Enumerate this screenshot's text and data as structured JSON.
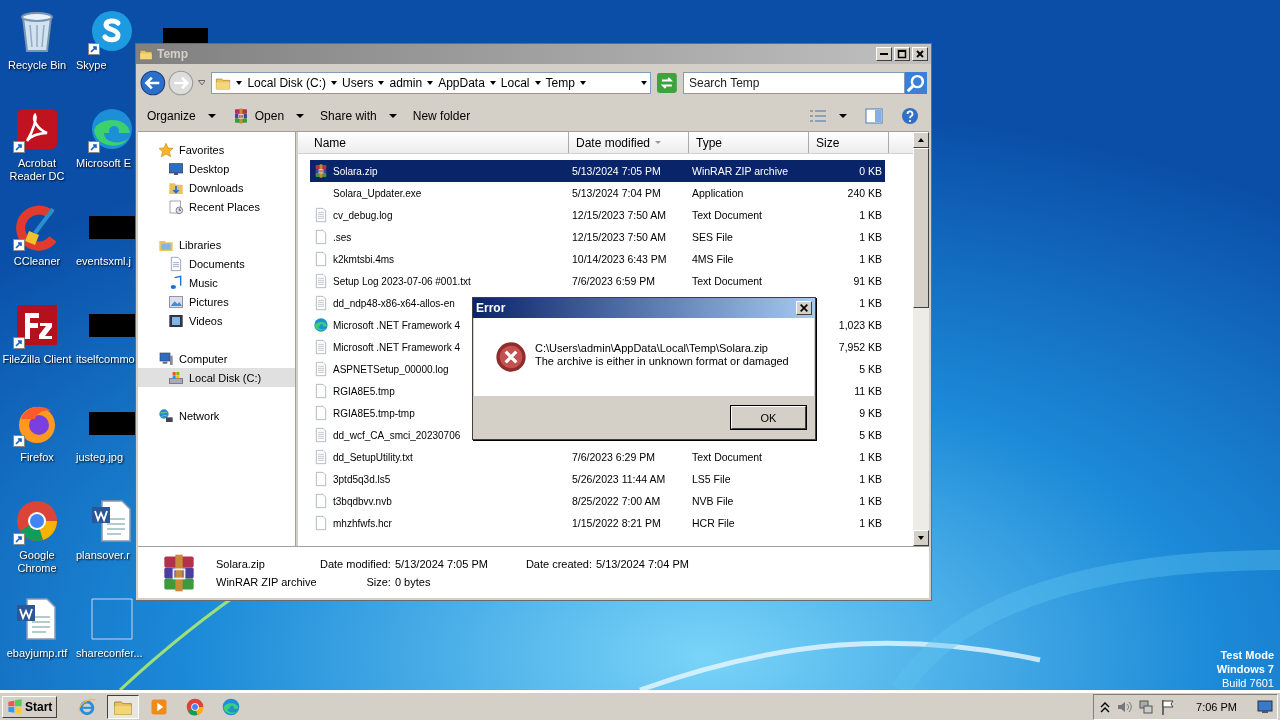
{
  "desktop": {
    "icons": [
      {
        "label": "Recycle Bin",
        "kind": "recycle",
        "shortcut": false
      },
      {
        "label": "Skype",
        "kind": "skype",
        "shortcut": true
      },
      {
        "label": "Acrobat Reader DC",
        "kind": "acrobat",
        "shortcut": true
      },
      {
        "label": "Microsoft E",
        "kind": "edge",
        "shortcut": true
      },
      {
        "label": "CCleaner",
        "kind": "ccleaner",
        "shortcut": true
      },
      {
        "label": "eventsxml.j",
        "kind": "redacted",
        "shortcut": false
      },
      {
        "label": "FileZilla Client",
        "kind": "filezilla",
        "shortcut": true
      },
      {
        "label": "itselfcommo",
        "kind": "redacted",
        "shortcut": false
      },
      {
        "label": "Firefox",
        "kind": "firefox",
        "shortcut": true
      },
      {
        "label": "justeg.jpg",
        "kind": "redacted",
        "shortcut": false
      },
      {
        "label": "Google Chrome",
        "kind": "chrome",
        "shortcut": true
      },
      {
        "label": "plansover.r",
        "kind": "word",
        "shortcut": false
      },
      {
        "label": "ebayjump.rtf",
        "kind": "word",
        "shortcut": false
      },
      {
        "label": "shareconfer...",
        "kind": "blank",
        "shortcut": false
      }
    ],
    "os_notice": [
      "Test Mode",
      "Windows 7",
      "Build 7601"
    ]
  },
  "explorer": {
    "title": "Temp",
    "breadcrumb": [
      "Local Disk (C:)",
      "Users",
      "admin",
      "AppData",
      "Local",
      "Temp"
    ],
    "search": {
      "placeholder": "Search Temp"
    },
    "toolbar": [
      {
        "label": "Organize",
        "menu": true,
        "kind": "plain"
      },
      {
        "label": "Open",
        "menu": true,
        "kind": "winrar"
      },
      {
        "label": "Share with",
        "menu": true,
        "kind": "plain"
      },
      {
        "label": "New folder",
        "menu": false,
        "kind": "plain"
      }
    ],
    "nav": [
      {
        "label": "Favorites",
        "kind": "star",
        "selected": false,
        "children": [
          {
            "label": "Desktop",
            "kind": "desktop",
            "selected": false
          },
          {
            "label": "Downloads",
            "kind": "downloads",
            "selected": false
          },
          {
            "label": "Recent Places",
            "kind": "recent",
            "selected": false
          }
        ]
      },
      {
        "label": "Libraries",
        "kind": "libraries",
        "selected": false,
        "children": [
          {
            "label": "Documents",
            "kind": "documents",
            "selected": false
          },
          {
            "label": "Music",
            "kind": "music",
            "selected": false
          },
          {
            "label": "Pictures",
            "kind": "pictures",
            "selected": false
          },
          {
            "label": "Videos",
            "kind": "videos",
            "selected": false
          }
        ]
      },
      {
        "label": "Computer",
        "kind": "computer",
        "selected": false,
        "children": [
          {
            "label": "Local Disk (C:)",
            "kind": "disk",
            "selected": true
          }
        ]
      },
      {
        "label": "Network",
        "kind": "network",
        "selected": false
      }
    ],
    "columns": [
      {
        "label": "Name",
        "sorted": false
      },
      {
        "label": "Date modified",
        "sorted": true
      },
      {
        "label": "Type",
        "sorted": false
      },
      {
        "label": "Size",
        "sorted": false
      }
    ],
    "files": [
      {
        "name": "Solara.zip",
        "date": "5/13/2024 7:05 PM",
        "type": "WinRAR ZIP archive",
        "size": "0 KB",
        "kind": "winrar",
        "selected": true
      },
      {
        "name": "Solara_Updater.exe",
        "date": "5/13/2024 7:04 PM",
        "type": "Application",
        "size": "240 KB",
        "kind": "none",
        "selected": false
      },
      {
        "name": "cv_debug.log",
        "date": "12/15/2023 7:50 AM",
        "type": "Text Document",
        "size": "1 KB",
        "kind": "text",
        "selected": false
      },
      {
        "name": ".ses",
        "date": "12/15/2023 7:50 AM",
        "type": "SES File",
        "size": "1 KB",
        "kind": "blank",
        "selected": false
      },
      {
        "name": "k2kmtsbi.4ms",
        "date": "10/14/2023 6:43 PM",
        "type": "4MS File",
        "size": "1 KB",
        "kind": "blank",
        "selected": false
      },
      {
        "name": "Setup Log 2023-07-06 #001.txt",
        "date": "7/6/2023 6:59 PM",
        "type": "Text Document",
        "size": "91 KB",
        "kind": "text",
        "selected": false
      },
      {
        "name": "dd_ndp48-x86-x64-allos-en",
        "size": "1 KB",
        "kind": "text",
        "selected": false
      },
      {
        "name": "Microsoft .NET Framework 4",
        "size": "1,023 KB",
        "kind": "edge",
        "selected": false
      },
      {
        "name": "Microsoft .NET Framework 4",
        "size": "7,952 KB",
        "kind": "text",
        "selected": false
      },
      {
        "name": "ASPNETSetup_00000.log",
        "size": "5 KB",
        "kind": "text",
        "selected": false
      },
      {
        "name": "RGIA8E5.tmp",
        "size": "11 KB",
        "kind": "blank",
        "selected": false
      },
      {
        "name": "RGIA8E5.tmp-tmp",
        "size": "9 KB",
        "kind": "blank",
        "selected": false
      },
      {
        "name": "dd_wcf_CA_smci_20230706",
        "size": "5 KB",
        "kind": "text",
        "selected": false
      },
      {
        "name": "dd_SetupUtility.txt",
        "date": "7/6/2023 6:29 PM",
        "type": "Text Document",
        "size": "1 KB",
        "kind": "text",
        "selected": false
      },
      {
        "name": "3ptd5q3d.ls5",
        "date": "5/26/2023 11:44 AM",
        "type": "LS5 File",
        "size": "1 KB",
        "kind": "blank",
        "selected": false
      },
      {
        "name": "t3bqdbvv.nvb",
        "date": "8/25/2022 7:00 AM",
        "type": "NVB File",
        "size": "1 KB",
        "kind": "blank",
        "selected": false
      },
      {
        "name": "mhzhfwfs.hcr",
        "date": "1/15/2022 8:21 PM",
        "type": "HCR File",
        "size": "1 KB",
        "kind": "blank",
        "selected": false
      }
    ],
    "details": {
      "name": "Solara.zip",
      "type": "WinRAR ZIP archive",
      "fields": [
        {
          "label": "Date modified:",
          "value": "5/13/2024 7:05 PM"
        },
        {
          "label": "Size:",
          "value": "0 bytes"
        },
        {
          "label": "Date created:",
          "value": "5/13/2024 7:04 PM"
        }
      ]
    }
  },
  "dialog": {
    "title": "Error",
    "lines": [
      "C:\\Users\\admin\\AppData\\Local\\Temp\\Solara.zip",
      "The archive is either in unknown format or damaged"
    ],
    "button": "OK"
  },
  "taskbar": {
    "start": "Start",
    "apps": [
      {
        "kind": "ie",
        "active": false
      },
      {
        "kind": "explorer",
        "active": true
      },
      {
        "kind": "media",
        "active": false
      },
      {
        "kind": "chrome",
        "active": false
      },
      {
        "kind": "edge",
        "active": false
      }
    ],
    "clock": "7:06 PM"
  }
}
